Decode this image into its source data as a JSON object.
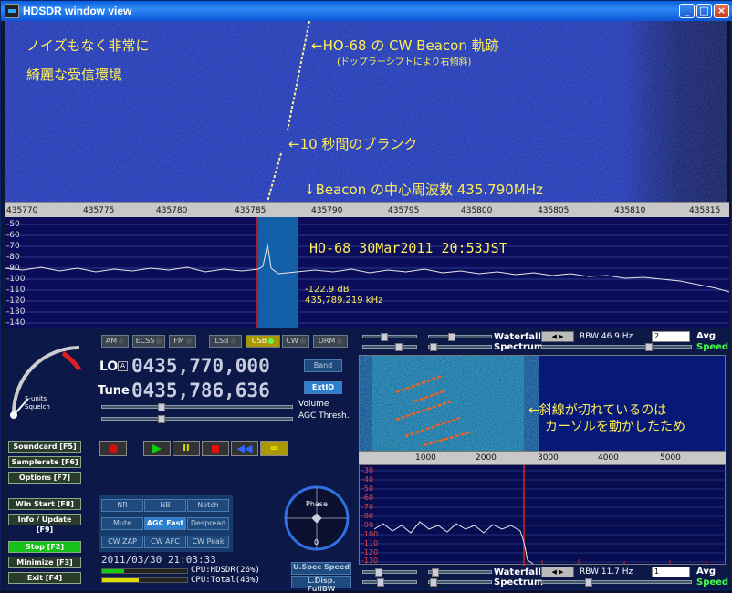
{
  "window": {
    "title": "HDSDR window view"
  },
  "annotations": {
    "clean": "ノイズもなく非常に",
    "clean2": "綺麗な受信環境",
    "trail": "←HO-68 の CW Beacon 軌跡",
    "doppler": "(ドップラーシフトにより右傾斜)",
    "blank": "←10 秒間のブランク",
    "center": "↓Beacon の中心周波数 435.790MHz",
    "stamp": "HO-68  30Mar2011 20:53JST",
    "cursor": "←斜線が切れているのは",
    "cursor2": "カーソルを動かしたため"
  },
  "freq_scale": [
    "435770",
    "435775",
    "435780",
    "435785",
    "435790",
    "435795",
    "435800",
    "435805",
    "435810",
    "435815"
  ],
  "db_axis": [
    "-50",
    "-60",
    "-70",
    "-80",
    "-90",
    "-100",
    "-110",
    "-120",
    "-130",
    "-140"
  ],
  "cursor_readout": {
    "db": "-122.9 dB",
    "freq": "435,789.219 kHz"
  },
  "smeter": {
    "label1": "S-units",
    "label2": "Squelch"
  },
  "modes": [
    {
      "label": "AM",
      "active": false
    },
    {
      "label": "ECSS",
      "active": false
    },
    {
      "label": "FM",
      "active": false
    },
    {
      "label": "LSB",
      "active": false
    },
    {
      "label": "USB",
      "active": true
    },
    {
      "label": "CW",
      "active": false
    },
    {
      "label": "DRM",
      "active": false
    }
  ],
  "lo": {
    "label": "LO",
    "value": "0435,770,000"
  },
  "tune": {
    "label": "Tune",
    "value": "0435,786,636"
  },
  "buttons": {
    "band": "Band",
    "extio": "ExtIO",
    "volume": "Volume",
    "agc": "AGC Thresh.",
    "soundcard": "Soundcard   [F5]",
    "samplerate": "Samplerate  [F6]",
    "options": "Options      [F7]",
    "winstart": "Win Start    [F8]",
    "info": "Info / Update [F9]",
    "stop": "Stop        [F2]",
    "minimize": "Minimize   [F3]",
    "exit": "Exit         [F4]",
    "uspec": "U.Spec Speed",
    "ldisp": "L.Disp. FullBW"
  },
  "dsp": [
    [
      "NR",
      "NB",
      "Notch"
    ],
    [
      "Mute",
      "AGC Fast",
      "Despread"
    ],
    [
      "CW ZAP",
      "CW AFC",
      "CW Peak"
    ]
  ],
  "phase": {
    "label": "Phase",
    "value": "0"
  },
  "status": {
    "datetime": "2011/03/30 21:03:33",
    "cpu_hdsdr": "CPU:HDSDR(26%)",
    "cpu_total": "CPU:Total(43%)",
    "cpu_hdsdr_level": 0.26,
    "cpu_total_level": 0.43
  },
  "top_panel": {
    "waterfall": "Waterfall",
    "spectrum": "Spectrum",
    "rbw": "RBW 46.9 Hz",
    "avg_value": "2",
    "avg": "Avg",
    "speed": "Speed"
  },
  "bottom_panel": {
    "waterfall": "Waterfall",
    "spectrum": "Spectrum",
    "rbw": "RBW 11.7 Hz",
    "avg_value": "1",
    "avg": "Avg",
    "speed": "Speed"
  },
  "mini_freq": [
    "1000",
    "2000",
    "3000",
    "4000",
    "5000"
  ],
  "mini_db": [
    "-30",
    "-40",
    "-50",
    "-60",
    "-70",
    "-80",
    "-90",
    "-100",
    "-110",
    "-120",
    "-130"
  ]
}
